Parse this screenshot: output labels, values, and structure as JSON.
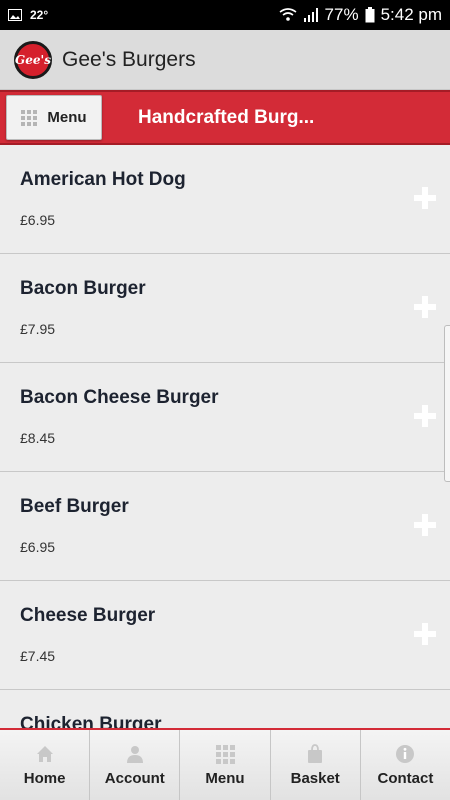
{
  "status_bar": {
    "temperature": "22°",
    "battery": "77%",
    "time": "5:42 pm"
  },
  "app": {
    "title": "Gee's Burgers",
    "logo_text": "Gee's"
  },
  "toolbar": {
    "menu_label": "Menu",
    "category_title": "Handcrafted Burg..."
  },
  "items": [
    {
      "name": "American Hot Dog",
      "price": "£6.95"
    },
    {
      "name": "Bacon Burger",
      "price": "£7.95"
    },
    {
      "name": "Bacon Cheese Burger",
      "price": "£8.45"
    },
    {
      "name": "Beef Burger",
      "price": "£6.95"
    },
    {
      "name": "Cheese Burger",
      "price": "£7.45"
    },
    {
      "name": "Chicken Burger",
      "price": ""
    }
  ],
  "tabs": [
    {
      "label": "Home",
      "icon": "home-icon"
    },
    {
      "label": "Account",
      "icon": "person-icon"
    },
    {
      "label": "Menu",
      "icon": "grid-icon"
    },
    {
      "label": "Basket",
      "icon": "bag-icon"
    },
    {
      "label": "Contact",
      "icon": "info-icon"
    }
  ],
  "colors": {
    "brand_red": "#d32b37",
    "background": "#ededed"
  }
}
